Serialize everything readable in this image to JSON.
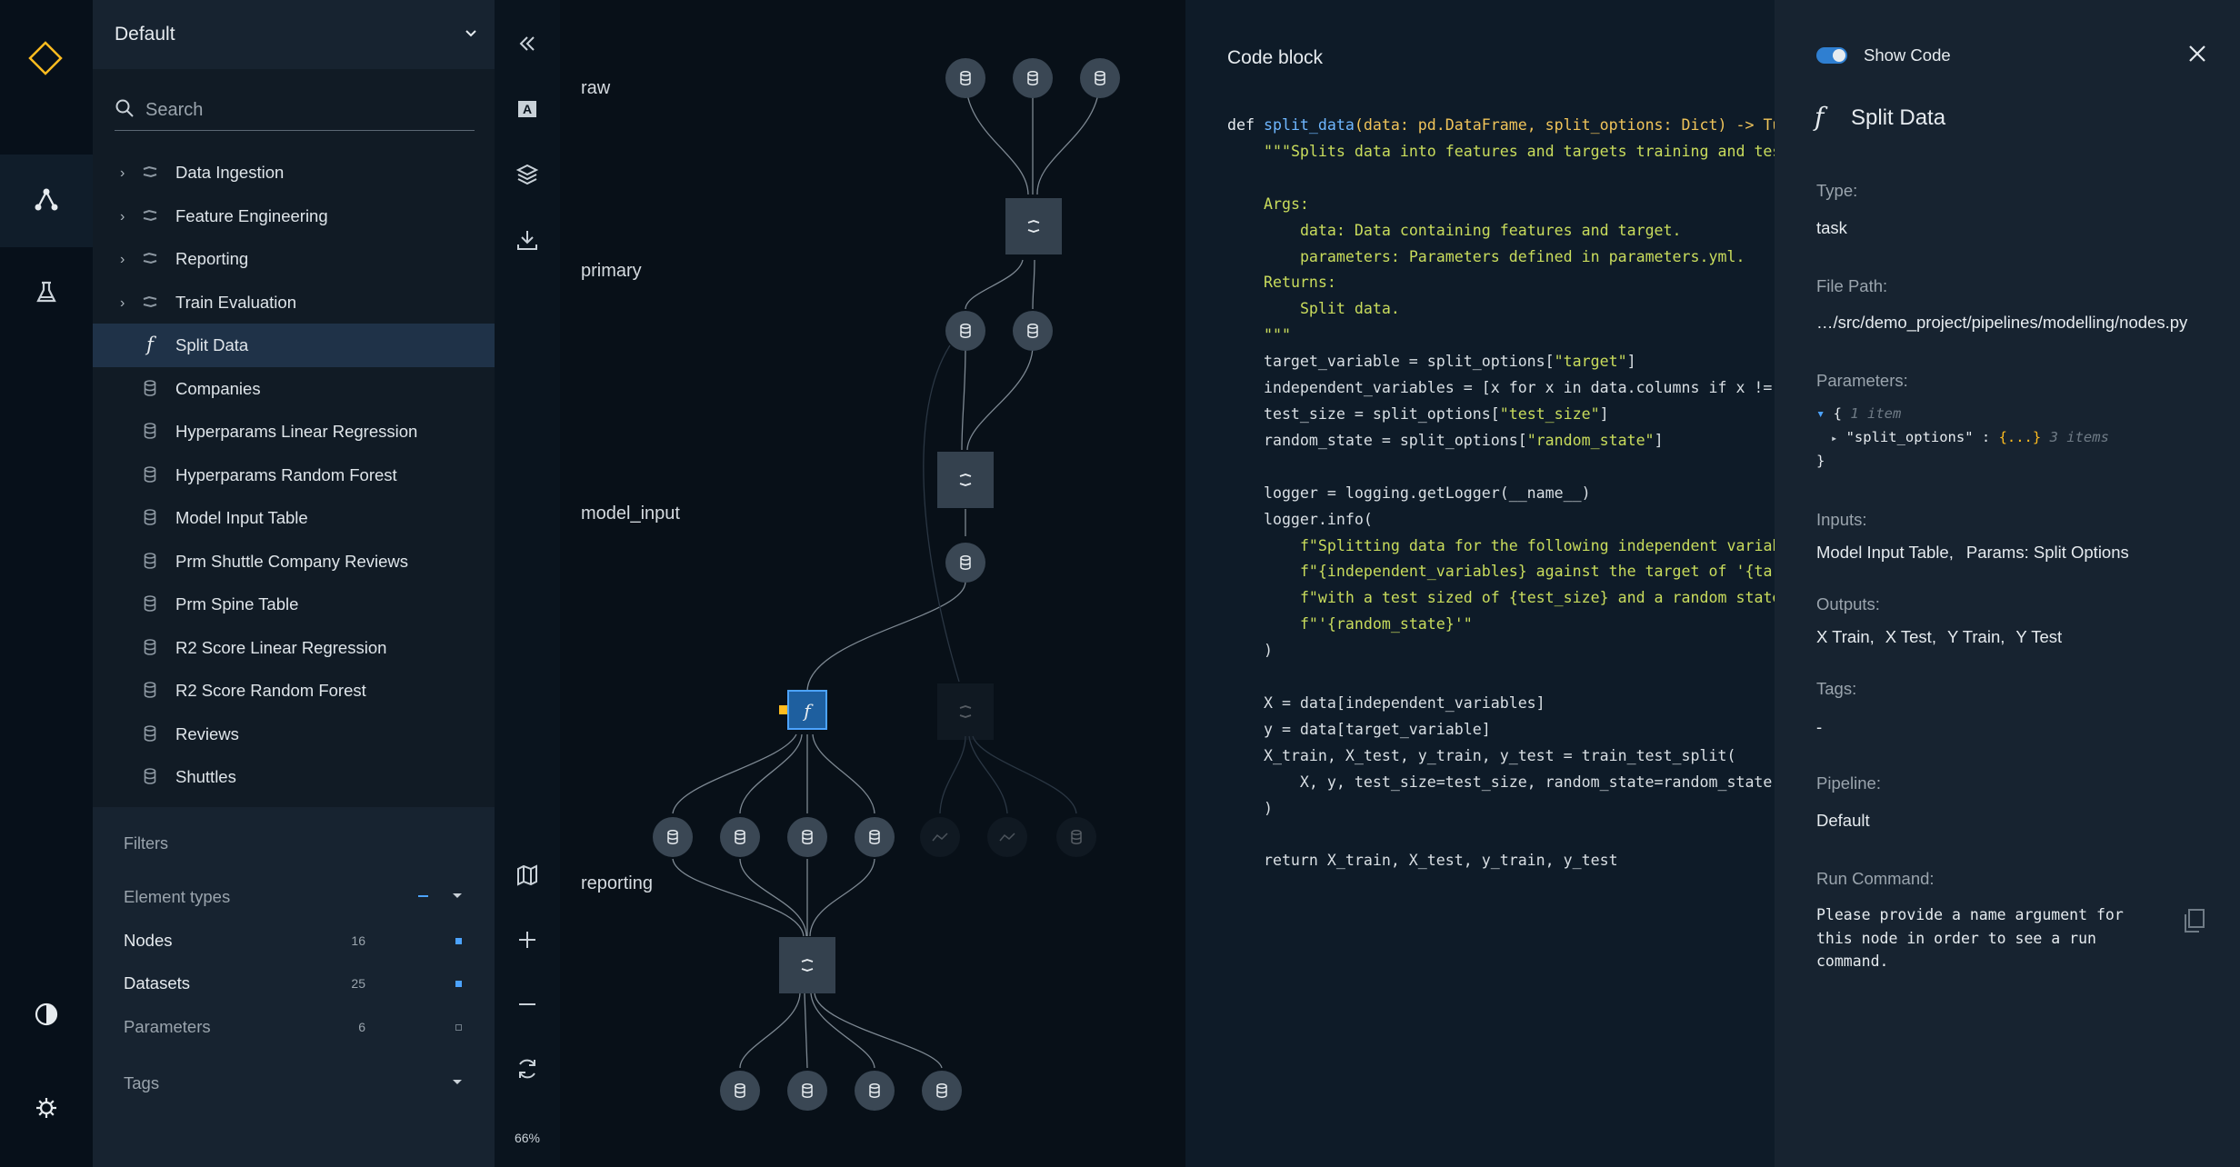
{
  "pipeline": {
    "selected": "Default"
  },
  "search": {
    "placeholder": "Search"
  },
  "tree": [
    {
      "label": "Data Ingestion",
      "kind": "pipeline",
      "expandable": true
    },
    {
      "label": "Feature Engineering",
      "kind": "pipeline",
      "expandable": true
    },
    {
      "label": "Reporting",
      "kind": "pipeline",
      "expandable": true
    },
    {
      "label": "Train Evaluation",
      "kind": "pipeline",
      "expandable": true
    },
    {
      "label": "Split Data",
      "kind": "task",
      "active": true
    },
    {
      "label": "Companies",
      "kind": "dataset"
    },
    {
      "label": "Hyperparams Linear Regression",
      "kind": "dataset"
    },
    {
      "label": "Hyperparams Random Forest",
      "kind": "dataset"
    },
    {
      "label": "Model Input Table",
      "kind": "dataset"
    },
    {
      "label": "Prm Shuttle Company Reviews",
      "kind": "dataset"
    },
    {
      "label": "Prm Spine Table",
      "kind": "dataset"
    },
    {
      "label": "R2 Score Linear Regression",
      "kind": "dataset"
    },
    {
      "label": "R2 Score Random Forest",
      "kind": "dataset"
    },
    {
      "label": "Reviews",
      "kind": "dataset"
    },
    {
      "label": "Shuttles",
      "kind": "dataset"
    }
  ],
  "filters": {
    "title": "Filters",
    "element_types": "Element types",
    "nodes": {
      "label": "Nodes",
      "count": "16"
    },
    "datasets": {
      "label": "Datasets",
      "count": "25"
    },
    "parameters": {
      "label": "Parameters",
      "count": "6"
    },
    "tags": "Tags"
  },
  "toolbar": {
    "zoom": "66%"
  },
  "graph": {
    "layers": [
      "raw",
      "primary",
      "model_input",
      "reporting"
    ]
  },
  "code": {
    "title": "Code block",
    "line1_def": "def ",
    "line1_fn": "split_data",
    "line1_args": "(data: pd.DataFrame, split_options: Dict) -> Tup"
  },
  "meta": {
    "show_code": "Show Code",
    "node_name": "Split Data",
    "type_label": "Type:",
    "type_value": "task",
    "filepath_label": "File Path:",
    "filepath_value": "…/src/demo_project/pipelines/modelling/nodes.py",
    "params_label": "Parameters:",
    "params_items": "1 item",
    "params_key": "\"split_options\"",
    "params_value": "{...}",
    "params_sub_items": "3 items",
    "inputs_label": "Inputs:",
    "inputs": [
      "Model Input Table,",
      "Params: Split Options"
    ],
    "outputs_label": "Outputs:",
    "outputs": [
      "X Train,",
      "X Test,",
      "Y Train,",
      "Y Test"
    ],
    "tags_label": "Tags:",
    "tags_value": "-",
    "pipeline_label": "Pipeline:",
    "pipeline_value": "Default",
    "run_label": "Run Command:",
    "run_value": [
      "Please provide a name argument for",
      "this node in order to see a run",
      "command."
    ]
  },
  "colors": {
    "accent": "#ffbc1f",
    "selected": "#2f7fd1",
    "active_row": "#1f3248"
  }
}
